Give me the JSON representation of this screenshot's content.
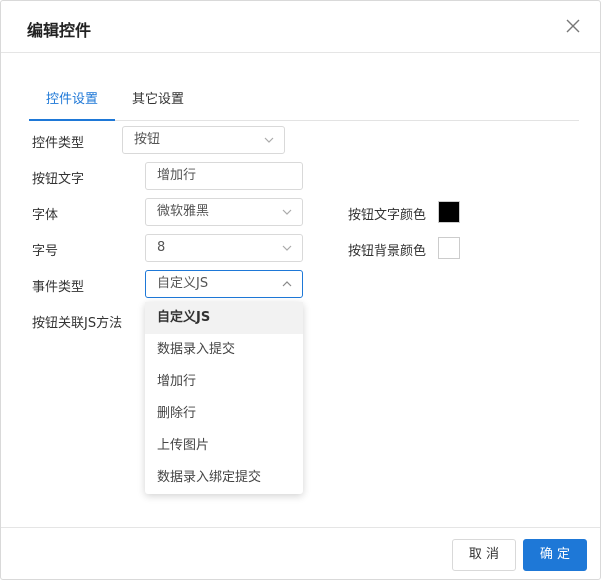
{
  "dialog": {
    "title": "编辑控件"
  },
  "tabs": [
    {
      "label": "控件设置",
      "active": true
    },
    {
      "label": "其它设置",
      "active": false
    }
  ],
  "form": {
    "control_type": {
      "label": "控件类型",
      "value": "按钮"
    },
    "button_text": {
      "label": "按钮文字",
      "value": "增加行"
    },
    "font": {
      "label": "字体",
      "value": "微软雅黑"
    },
    "font_size": {
      "label": "字号",
      "value": "8"
    },
    "event_type": {
      "label": "事件类型",
      "value": "自定义JS"
    },
    "js_method": {
      "label": "按钮关联JS方法"
    },
    "text_color": {
      "label": "按钮文字颜色",
      "color": "#000000"
    },
    "bg_color": {
      "label": "按钮背景颜色",
      "color": "#ffffff"
    }
  },
  "dropdown": {
    "options": [
      "自定义JS",
      "数据录入提交",
      "增加行",
      "删除行",
      "上传图片",
      "数据录入绑定提交"
    ],
    "selected_index": 0
  },
  "footer": {
    "cancel_label": "取 消",
    "ok_label": "确 定"
  },
  "colors": {
    "accent": "#1e78d7",
    "border": "#d9d9d9"
  }
}
